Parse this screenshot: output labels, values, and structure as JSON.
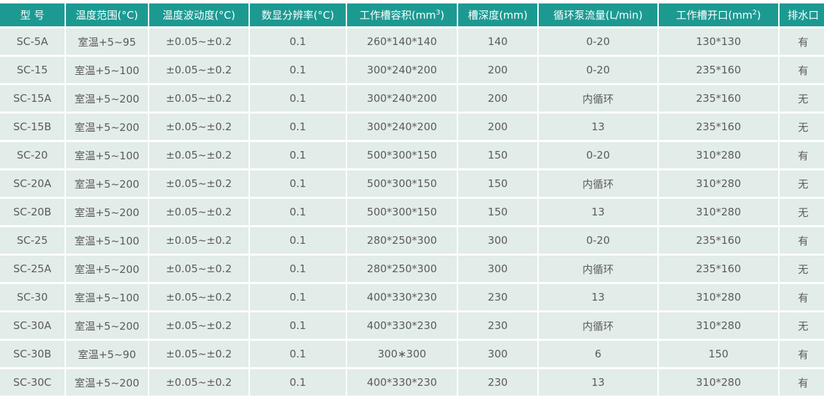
{
  "columns": [
    {
      "text": "型 号"
    },
    {
      "text": "温度范围(°C)"
    },
    {
      "text": "温度波动度(°C)"
    },
    {
      "text": "数显分辨率(°C)"
    },
    {
      "text": "工作槽容积(mm",
      "sup": "3",
      "tail": ")"
    },
    {
      "text": "槽深度(mm)"
    },
    {
      "text": "循环泵流量(L/min)"
    },
    {
      "text": "工作槽开口(mm",
      "sup": "2",
      "tail": ")"
    },
    {
      "text": "排水口"
    }
  ],
  "rows": [
    [
      "SC-5A",
      "室温+5~95",
      "±0.05~±0.2",
      "0.1",
      "260*140*140",
      "140",
      "0-20",
      "130*130",
      "有"
    ],
    [
      "SC-15",
      "室温+5~100",
      "±0.05~±0.2",
      "0.1",
      "300*240*200",
      "200",
      "0-20",
      "235*160",
      "有"
    ],
    [
      "SC-15A",
      "室温+5~200",
      "±0.05~±0.2",
      "0.1",
      "300*240*200",
      "200",
      "内循环",
      "235*160",
      "无"
    ],
    [
      "SC-15B",
      "室温+5~200",
      "±0.05~±0.2",
      "0.1",
      "300*240*200",
      "200",
      "13",
      "235*160",
      "无"
    ],
    [
      "SC-20",
      "室温+5~100",
      "±0.05~±0.2",
      "0.1",
      "500*300*150",
      "150",
      "0-20",
      "310*280",
      "有"
    ],
    [
      "SC-20A",
      "室温+5~200",
      "±0.05~±0.2",
      "0.1",
      "500*300*150",
      "150",
      "内循环",
      "310*280",
      "无"
    ],
    [
      "SC-20B",
      "室温+5~200",
      "±0.05~±0.2",
      "0.1",
      "500*300*150",
      "150",
      "13",
      "310*280",
      "无"
    ],
    [
      "SC-25",
      "室温+5~100",
      "±0.05~±0.2",
      "0.1",
      "280*250*300",
      "300",
      "0-20",
      "235*160",
      "有"
    ],
    [
      "SC-25A",
      "室温+5~200",
      "±0.05~±0.2",
      "0.1",
      "280*250*300",
      "300",
      "内循环",
      "235*160",
      "无"
    ],
    [
      "SC-30",
      "室温+5~100",
      "±0.05~±0.2",
      "0.1",
      "400*330*230",
      "230",
      "13",
      "310*280",
      "有"
    ],
    [
      "SC-30A",
      "室温+5~200",
      "±0.05~±0.2",
      "0.1",
      "400*330*230",
      "230",
      "内循环",
      "310*280",
      "无"
    ],
    [
      "SC-30B",
      "室温+5~90",
      "±0.05~±0.2",
      "0.1",
      "300∗300",
      "300",
      "6",
      "150",
      "有"
    ],
    [
      "SC-30C",
      "室温+5~200",
      "±0.05~±0.2",
      "0.1",
      "400*330*230",
      "230",
      "13",
      "310*280",
      "有"
    ]
  ],
  "colors": {
    "header_bg": "#1c9a92",
    "header_text": "#ffffff",
    "cell_bg": "#e2ece9",
    "cell_text": "#5b5b5b"
  }
}
